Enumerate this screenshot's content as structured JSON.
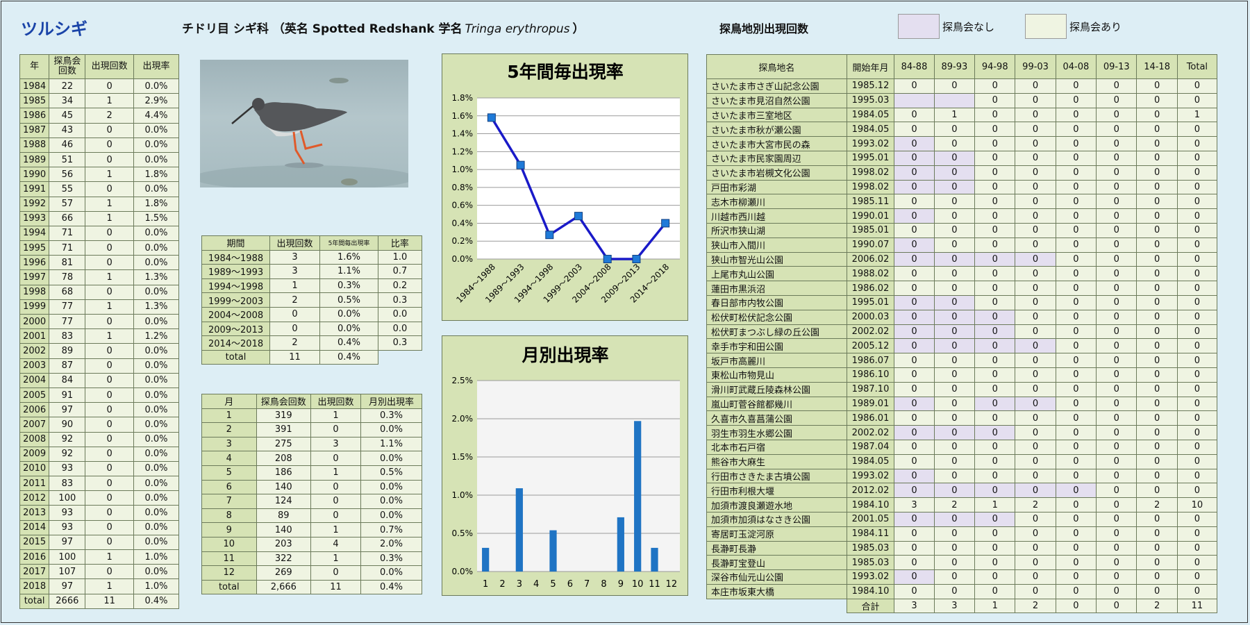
{
  "header": {
    "title": "ツルシギ",
    "subtitle_prefix": "チドリ目 シギ科  （英名 Spotted Redshank    学名",
    "scientific_name": "Tringa erythropus",
    "subtitle_suffix": "）",
    "site_section_title": "探鳥地別出現回数",
    "legend_none": "探鳥会なし",
    "legend_yes": "探鳥会あり"
  },
  "colors": {
    "legend_none": "#e4dff0",
    "legend_yes": "#eff4e2",
    "header_cell": "#d6e3b5",
    "line": "#1a1ac8",
    "bar": "#1f74c4"
  },
  "year_table": {
    "headers": [
      "年",
      "探鳥会\n回数",
      "出現回数",
      "出現率"
    ],
    "rows": [
      [
        "1984",
        "22",
        "0",
        "0.0%"
      ],
      [
        "1985",
        "34",
        "1",
        "2.9%"
      ],
      [
        "1986",
        "45",
        "2",
        "4.4%"
      ],
      [
        "1987",
        "43",
        "0",
        "0.0%"
      ],
      [
        "1988",
        "46",
        "0",
        "0.0%"
      ],
      [
        "1989",
        "51",
        "0",
        "0.0%"
      ],
      [
        "1990",
        "56",
        "1",
        "1.8%"
      ],
      [
        "1991",
        "55",
        "0",
        "0.0%"
      ],
      [
        "1992",
        "57",
        "1",
        "1.8%"
      ],
      [
        "1993",
        "66",
        "1",
        "1.5%"
      ],
      [
        "1994",
        "71",
        "0",
        "0.0%"
      ],
      [
        "1995",
        "71",
        "0",
        "0.0%"
      ],
      [
        "1996",
        "81",
        "0",
        "0.0%"
      ],
      [
        "1997",
        "78",
        "1",
        "1.3%"
      ],
      [
        "1998",
        "68",
        "0",
        "0.0%"
      ],
      [
        "1999",
        "77",
        "1",
        "1.3%"
      ],
      [
        "2000",
        "77",
        "0",
        "0.0%"
      ],
      [
        "2001",
        "83",
        "1",
        "1.2%"
      ],
      [
        "2002",
        "89",
        "0",
        "0.0%"
      ],
      [
        "2003",
        "87",
        "0",
        "0.0%"
      ],
      [
        "2004",
        "84",
        "0",
        "0.0%"
      ],
      [
        "2005",
        "91",
        "0",
        "0.0%"
      ],
      [
        "2006",
        "97",
        "0",
        "0.0%"
      ],
      [
        "2007",
        "90",
        "0",
        "0.0%"
      ],
      [
        "2008",
        "92",
        "0",
        "0.0%"
      ],
      [
        "2009",
        "92",
        "0",
        "0.0%"
      ],
      [
        "2010",
        "93",
        "0",
        "0.0%"
      ],
      [
        "2011",
        "83",
        "0",
        "0.0%"
      ],
      [
        "2012",
        "100",
        "0",
        "0.0%"
      ],
      [
        "2013",
        "93",
        "0",
        "0.0%"
      ],
      [
        "2014",
        "93",
        "0",
        "0.0%"
      ],
      [
        "2015",
        "97",
        "0",
        "0.0%"
      ],
      [
        "2016",
        "100",
        "1",
        "1.0%"
      ],
      [
        "2017",
        "107",
        "0",
        "0.0%"
      ],
      [
        "2018",
        "97",
        "1",
        "1.0%"
      ],
      [
        "total",
        "2666",
        "11",
        "0.4%"
      ]
    ]
  },
  "period_table": {
    "headers": [
      "期間",
      "出現回数",
      "5年間毎出現率",
      "比率"
    ],
    "rows": [
      [
        "1984～1988",
        "3",
        "1.6%",
        "1.0"
      ],
      [
        "1989～1993",
        "3",
        "1.1%",
        "0.7"
      ],
      [
        "1994～1998",
        "1",
        "0.3%",
        "0.2"
      ],
      [
        "1999～2003",
        "2",
        "0.5%",
        "0.3"
      ],
      [
        "2004～2008",
        "0",
        "0.0%",
        "0.0"
      ],
      [
        "2009～2013",
        "0",
        "0.0%",
        "0.0"
      ],
      [
        "2014～2018",
        "2",
        "0.4%",
        "0.3"
      ],
      [
        "total",
        "11",
        "0.4%",
        ""
      ]
    ]
  },
  "month_table": {
    "headers": [
      "月",
      "探鳥会回数",
      "出現回数",
      "月別出現率"
    ],
    "rows": [
      [
        "1",
        "319",
        "1",
        "0.3%"
      ],
      [
        "2",
        "391",
        "0",
        "0.0%"
      ],
      [
        "3",
        "275",
        "3",
        "1.1%"
      ],
      [
        "4",
        "208",
        "0",
        "0.0%"
      ],
      [
        "5",
        "186",
        "1",
        "0.5%"
      ],
      [
        "6",
        "140",
        "0",
        "0.0%"
      ],
      [
        "7",
        "124",
        "0",
        "0.0%"
      ],
      [
        "8",
        "89",
        "0",
        "0.0%"
      ],
      [
        "9",
        "140",
        "1",
        "0.7%"
      ],
      [
        "10",
        "203",
        "4",
        "2.0%"
      ],
      [
        "11",
        "322",
        "1",
        "0.3%"
      ],
      [
        "12",
        "269",
        "0",
        "0.0%"
      ],
      [
        "total",
        "2,666",
        "11",
        "0.4%"
      ]
    ]
  },
  "site_table": {
    "headers": [
      "探鳥地名",
      "開始年月",
      "84-88",
      "89-93",
      "94-98",
      "99-03",
      "04-08",
      "09-13",
      "14-18",
      "Total"
    ],
    "rows": [
      [
        "さいたま市さぎ山記念公園",
        "1985.12",
        [
          "0",
          "0",
          "0",
          "0",
          "0",
          "0",
          "0"
        ],
        "0",
        []
      ],
      [
        "さいたま市見沼自然公園",
        "1995.03",
        [
          "",
          "",
          "0",
          "0",
          "0",
          "0",
          "0"
        ],
        "0",
        [
          0,
          1
        ]
      ],
      [
        "さいたま市三室地区",
        "1984.05",
        [
          "0",
          "1",
          "0",
          "0",
          "0",
          "0",
          "0"
        ],
        "1",
        []
      ],
      [
        "さいたま市秋が瀬公園",
        "1984.05",
        [
          "0",
          "0",
          "0",
          "0",
          "0",
          "0",
          "0"
        ],
        "0",
        []
      ],
      [
        "さいたま市大宮市民の森",
        "1993.02",
        [
          "0",
          "0",
          "0",
          "0",
          "0",
          "0",
          "0"
        ],
        "0",
        [
          0
        ]
      ],
      [
        "さいたま市民家園周辺",
        "1995.01",
        [
          "0",
          "0",
          "0",
          "0",
          "0",
          "0",
          "0"
        ],
        "0",
        [
          0,
          1
        ]
      ],
      [
        "さいたま市岩槻文化公園",
        "1998.02",
        [
          "0",
          "0",
          "0",
          "0",
          "0",
          "0",
          "0"
        ],
        "0",
        [
          0,
          1
        ]
      ],
      [
        "戸田市彩湖",
        "1998.02",
        [
          "0",
          "0",
          "0",
          "0",
          "0",
          "0",
          "0"
        ],
        "0",
        [
          0,
          1
        ]
      ],
      [
        "志木市柳瀬川",
        "1985.11",
        [
          "0",
          "0",
          "0",
          "0",
          "0",
          "0",
          "0"
        ],
        "0",
        []
      ],
      [
        "川越市西川越",
        "1990.01",
        [
          "0",
          "0",
          "0",
          "0",
          "0",
          "0",
          "0"
        ],
        "0",
        [
          0
        ]
      ],
      [
        "所沢市狭山湖",
        "1985.01",
        [
          "0",
          "0",
          "0",
          "0",
          "0",
          "0",
          "0"
        ],
        "0",
        []
      ],
      [
        "狭山市入間川",
        "1990.07",
        [
          "0",
          "0",
          "0",
          "0",
          "0",
          "0",
          "0"
        ],
        "0",
        [
          0
        ]
      ],
      [
        "狭山市智光山公園",
        "2006.02",
        [
          "0",
          "0",
          "0",
          "0",
          "0",
          "0",
          "0"
        ],
        "0",
        [
          0,
          1,
          2,
          3
        ]
      ],
      [
        "上尾市丸山公園",
        "1988.02",
        [
          "0",
          "0",
          "0",
          "0",
          "0",
          "0",
          "0"
        ],
        "0",
        []
      ],
      [
        "蓮田市黒浜沼",
        "1986.02",
        [
          "0",
          "0",
          "0",
          "0",
          "0",
          "0",
          "0"
        ],
        "0",
        []
      ],
      [
        "春日部市内牧公園",
        "1995.01",
        [
          "0",
          "0",
          "0",
          "0",
          "0",
          "0",
          "0"
        ],
        "0",
        [
          0,
          1
        ]
      ],
      [
        "松伏町松伏記念公園",
        "2000.03",
        [
          "0",
          "0",
          "0",
          "0",
          "0",
          "0",
          "0"
        ],
        "0",
        [
          0,
          1,
          2
        ]
      ],
      [
        "松伏町まつぶし緑の丘公園",
        "2002.02",
        [
          "0",
          "0",
          "0",
          "0",
          "0",
          "0",
          "0"
        ],
        "0",
        [
          0,
          1,
          2
        ]
      ],
      [
        "幸手市宇和田公園",
        "2005.12",
        [
          "0",
          "0",
          "0",
          "0",
          "0",
          "0",
          "0"
        ],
        "0",
        [
          0,
          1,
          2,
          3
        ]
      ],
      [
        "坂戸市高麗川",
        "1986.07",
        [
          "0",
          "0",
          "0",
          "0",
          "0",
          "0",
          "0"
        ],
        "0",
        []
      ],
      [
        "東松山市物見山",
        "1986.10",
        [
          "0",
          "0",
          "0",
          "0",
          "0",
          "0",
          "0"
        ],
        "0",
        []
      ],
      [
        "滑川町武蔵丘陵森林公園",
        "1987.10",
        [
          "0",
          "0",
          "0",
          "0",
          "0",
          "0",
          "0"
        ],
        "0",
        []
      ],
      [
        "嵐山町菅谷館都幾川",
        "1989.01",
        [
          "0",
          "0",
          "0",
          "0",
          "0",
          "0",
          "0"
        ],
        "0",
        [
          0,
          2,
          3
        ]
      ],
      [
        "久喜市久喜菖蒲公園",
        "1986.01",
        [
          "0",
          "0",
          "0",
          "0",
          "0",
          "0",
          "0"
        ],
        "0",
        []
      ],
      [
        "羽生市羽生水郷公園",
        "2002.02",
        [
          "0",
          "0",
          "0",
          "0",
          "0",
          "0",
          "0"
        ],
        "0",
        [
          0,
          1,
          2
        ]
      ],
      [
        "北本市石戸宿",
        "1987.04",
        [
          "0",
          "0",
          "0",
          "0",
          "0",
          "0",
          "0"
        ],
        "0",
        []
      ],
      [
        "熊谷市大麻生",
        "1984.05",
        [
          "0",
          "0",
          "0",
          "0",
          "0",
          "0",
          "0"
        ],
        "0",
        []
      ],
      [
        "行田市さきたま古墳公園",
        "1993.02",
        [
          "0",
          "0",
          "0",
          "0",
          "0",
          "0",
          "0"
        ],
        "0",
        [
          0
        ]
      ],
      [
        "行田市利根大堰",
        "2012.02",
        [
          "0",
          "0",
          "0",
          "0",
          "0",
          "0",
          "0"
        ],
        "0",
        [
          0,
          1,
          2,
          3,
          4
        ]
      ],
      [
        "加須市渡良瀬遊水地",
        "1984.10",
        [
          "3",
          "2",
          "1",
          "2",
          "0",
          "0",
          "2"
        ],
        "10",
        []
      ],
      [
        "加須市加須はなさき公園",
        "2001.05",
        [
          "0",
          "0",
          "0",
          "0",
          "0",
          "0",
          "0"
        ],
        "0",
        [
          0,
          1,
          2
        ]
      ],
      [
        "寄居町玉淀河原",
        "1984.11",
        [
          "0",
          "0",
          "0",
          "0",
          "0",
          "0",
          "0"
        ],
        "0",
        []
      ],
      [
        "長瀞町長瀞",
        "1985.03",
        [
          "0",
          "0",
          "0",
          "0",
          "0",
          "0",
          "0"
        ],
        "0",
        []
      ],
      [
        "長瀞町宝登山",
        "1985.03",
        [
          "0",
          "0",
          "0",
          "0",
          "0",
          "0",
          "0"
        ],
        "0",
        []
      ],
      [
        "深谷市仙元山公園",
        "1993.02",
        [
          "0",
          "0",
          "0",
          "0",
          "0",
          "0",
          "0"
        ],
        "0",
        [
          0
        ]
      ],
      [
        "本庄市坂東大橋",
        "1984.10",
        [
          "0",
          "0",
          "0",
          "0",
          "0",
          "0",
          "0"
        ],
        "0",
        []
      ]
    ],
    "total_label": "合計",
    "totals": [
      "3",
      "3",
      "1",
      "2",
      "0",
      "0",
      "2",
      "11"
    ]
  },
  "chart_data": [
    {
      "type": "line",
      "title": "5年間毎出現率",
      "categories": [
        "1984～1988",
        "1989～1993",
        "1994～1998",
        "1999～2003",
        "2004～2008",
        "2009～2013",
        "2014～2018"
      ],
      "values": [
        1.58,
        1.05,
        0.27,
        0.48,
        0.0,
        0.0,
        0.4
      ],
      "ylim": [
        0,
        1.8
      ],
      "yticks": [
        "0.0%",
        "0.2%",
        "0.4%",
        "0.6%",
        "0.8%",
        "1.0%",
        "1.2%",
        "1.4%",
        "1.6%",
        "1.8%"
      ],
      "grid": true
    },
    {
      "type": "bar",
      "title": "月別出現率",
      "categories": [
        "1",
        "2",
        "3",
        "4",
        "5",
        "6",
        "7",
        "8",
        "9",
        "10",
        "11",
        "12"
      ],
      "values": [
        0.31,
        0.0,
        1.09,
        0.0,
        0.54,
        0.0,
        0.0,
        0.0,
        0.71,
        1.97,
        0.31,
        0.0
      ],
      "ylim": [
        0,
        2.5
      ],
      "yticks": [
        "0.0%",
        "0.5%",
        "1.0%",
        "1.5%",
        "2.0%",
        "2.5%"
      ],
      "grid": true
    }
  ]
}
